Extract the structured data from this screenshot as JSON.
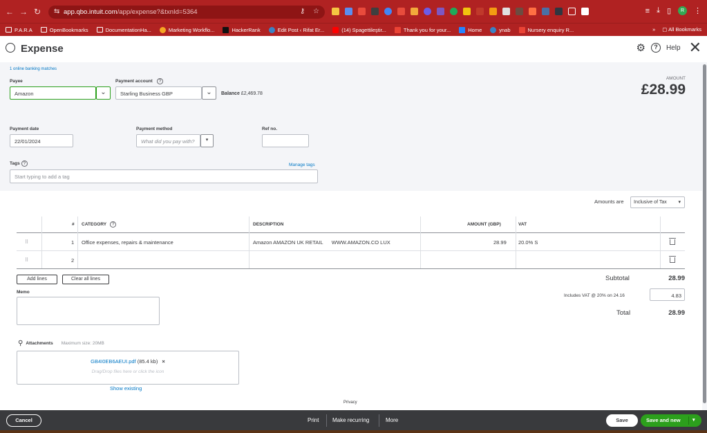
{
  "browser": {
    "url_domain": "app.qbo.intuit.com",
    "url_path": "/app/expense?&txnId=5364",
    "bookmarks": [
      "P.A.R.A",
      "OpenBookmarks",
      "DocumentationHa...",
      "Marketing Workflo...",
      "HackerRank",
      "Edit Post ‹ Rifat Er...",
      "(14) Spagettileştir...",
      "Thank you for your...",
      "Home",
      "ynab",
      "Nursery enquiry R..."
    ],
    "all_bookmarks": "All Bookmarks",
    "avatar_letter": "R"
  },
  "header": {
    "title": "Expense",
    "help": "Help"
  },
  "form": {
    "banking_matches": "1 online banking matches",
    "payee_label": "Payee",
    "payee_value": "Amazon",
    "payment_account_label": "Payment account",
    "payment_account_value": "Starling Business GBP",
    "balance_label": "Balance",
    "balance_value": "£2,469.78",
    "amount_label": "AMOUNT",
    "amount_value": "£28.99",
    "payment_date_label": "Payment date",
    "payment_date_value": "22/01/2024",
    "payment_method_label": "Payment method",
    "payment_method_placeholder": "What did you pay with?",
    "ref_label": "Ref no.",
    "ref_value": "",
    "tags_label": "Tags",
    "manage_tags": "Manage tags",
    "tags_placeholder": "Start typing to add a tag"
  },
  "lines": {
    "amounts_are_label": "Amounts are",
    "amounts_are_value": "Inclusive of Tax",
    "headers": {
      "num": "#",
      "category": "CATEGORY",
      "description": "DESCRIPTION",
      "amount": "AMOUNT (GBP)",
      "vat": "VAT"
    },
    "rows": [
      {
        "num": "1",
        "category": "Office expenses, repairs & maintenance",
        "description": "Amazon AMAZON UK RETAIL      WWW.AMAZON.CO LUX",
        "amount": "28.99",
        "vat": "20.0% S"
      },
      {
        "num": "2",
        "category": "",
        "description": "",
        "amount": "",
        "vat": ""
      }
    ],
    "add_lines": "Add lines",
    "clear_all_lines": "Clear all lines"
  },
  "memo": {
    "label": "Memo",
    "value": ""
  },
  "summary": {
    "subtotal_label": "Subtotal",
    "subtotal_value": "28.99",
    "vat_label": "Includes VAT @ 20% on 24.16",
    "vat_value": "4.83",
    "total_label": "Total",
    "total_value": "28.99"
  },
  "attachments": {
    "label": "Attachments",
    "max_size": "Maximum size: 20MB",
    "file_name": "GB4I0EB6AEUI.pdf",
    "file_size": "(85.4 kb)",
    "remove": "×",
    "drop_hint": "Drag/Drop files here or click the icon",
    "show_existing": "Show existing"
  },
  "privacy": "Privacy",
  "footer": {
    "cancel": "Cancel",
    "print": "Print",
    "make_recurring": "Make recurring",
    "more": "More",
    "save": "Save",
    "save_and_new": "Save and new"
  },
  "colors": {
    "browser_red": "#b02222",
    "qb_green": "#2ca01c",
    "link_blue": "#0077c5",
    "footer_dark": "#393a3d",
    "panel_gray": "#f4f5f8"
  }
}
